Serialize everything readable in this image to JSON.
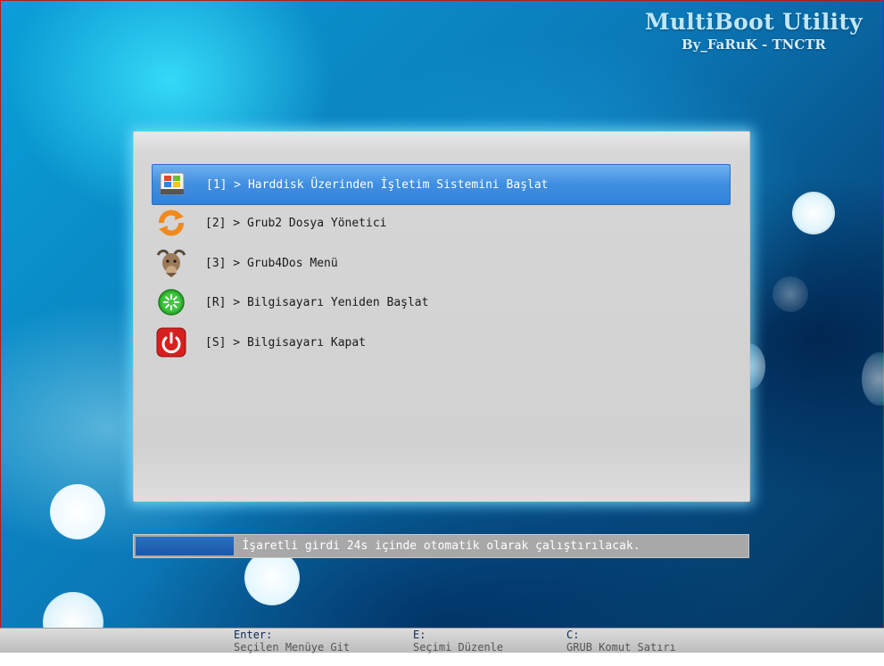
{
  "brand": {
    "title": "MultiBoot Utility",
    "author": "By_FaRuK - TNCTR"
  },
  "menu": {
    "items": [
      {
        "label": "[1] > Harddisk Üzerinden İşletim Sistemini Başlat",
        "icon": "windows-disk-icon",
        "selected": true
      },
      {
        "label": "[2] > Grub2 Dosya Yönetici",
        "icon": "refresh-arrows-icon",
        "selected": false
      },
      {
        "label": "[3] > Grub4Dos Menü",
        "icon": "gnu-head-icon",
        "selected": false
      },
      {
        "label": "[R] > Bilgisayarı Yeniden Başlat",
        "icon": "restart-icon",
        "selected": false
      },
      {
        "label": "[S] > Bilgisayarı Kapat",
        "icon": "power-icon",
        "selected": false
      }
    ]
  },
  "countdown": {
    "text": "İşaretli girdi 24s içinde otomatik olarak çalıştırılacak.",
    "progress": 0.16
  },
  "footer": {
    "hints": [
      {
        "key": "Enter:",
        "text": "Seçilen Menüye Git"
      },
      {
        "key": "E:",
        "text": "Seçimi Düzenle"
      },
      {
        "key": "C:",
        "text": "GRUB Komut Satırı"
      }
    ]
  },
  "colors": {
    "selection": "#3f8ee0",
    "panel": "#d3d3d3",
    "glow": "#78dcff"
  }
}
